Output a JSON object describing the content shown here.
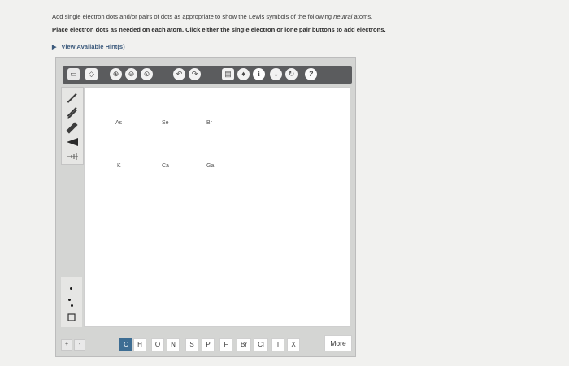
{
  "instructions": {
    "line1_pre": "Add single electron dots and/or pairs of dots as appropriate to show the Lewis symbols of the following ",
    "line1_em": "neutral",
    "line1_post": " atoms.",
    "line2": "Place electron dots as needed on each atom. Click either the single electron or lone pair buttons to add electrons.",
    "hints": "View Available Hint(s)"
  },
  "toolbar": {
    "info_label": "i",
    "help_label": "?",
    "icons": [
      "marquee-icon",
      "eraser-icon",
      "zoom-in-icon",
      "zoom-out-icon",
      "zoom-fit-icon",
      "undo-icon",
      "redo-icon",
      "template-icon",
      "clean-icon",
      "info-icon",
      "expand-icon",
      "redraw-icon",
      "help-icon"
    ]
  },
  "canvas": {
    "atoms": [
      "As",
      "Se",
      "Br",
      "K",
      "Ca",
      "Ga"
    ]
  },
  "bottom": {
    "zoom_plus": "+",
    "zoom_minus": "-",
    "elements": [
      "C",
      "H",
      "O",
      "N",
      "S",
      "P",
      "F",
      "Br",
      "Cl",
      "I",
      "X"
    ],
    "active_element": "C",
    "more_label": "More"
  }
}
